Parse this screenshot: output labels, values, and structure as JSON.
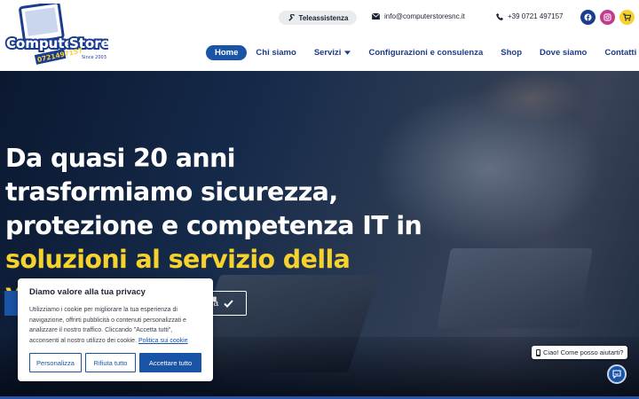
{
  "brand": {
    "logo_text": "Computer Store",
    "logo_phone": "0721497157",
    "logo_since": "Since 2003"
  },
  "topbar": {
    "teleassistenza": "Teleassistenza",
    "email": "info@computerstoresnc.it",
    "phone": "+39 0721 497157",
    "icons": [
      "wrench-icon",
      "mail-icon",
      "phone-icon",
      "facebook-icon",
      "instagram-icon",
      "cart-icon"
    ]
  },
  "nav": {
    "items": [
      {
        "label": "Home",
        "active": true
      },
      {
        "label": "Chi siamo"
      },
      {
        "label": "Servizi",
        "has_dropdown": true
      },
      {
        "label": "Configurazioni e consulenza"
      },
      {
        "label": "Shop"
      },
      {
        "label": "Dove siamo"
      },
      {
        "label": "Contatti"
      }
    ]
  },
  "hero": {
    "headline_white": "Da quasi 20 anni trasformiamo sicurezza, protezione e competenza IT in ",
    "headline_yellow": "soluzioni al servizio della vostra crescita",
    "headline_end": ".",
    "cta_secondary": "za"
  },
  "cookie": {
    "title": "Diamo valore alla tua privacy",
    "body": "Utilizziamo i cookie per migliorare la tua esperienza di navigazione, offrirti pubblicità o contenuti personalizzati e analizzare il nostro traffico. Cliccando \"Accetta tutti\", acconsenti al nostro utilizzo dei cookie. ",
    "policy_link": "Politica sui cookie",
    "btn_customize": "Personalizza",
    "btn_reject": "Rifiuta tutto",
    "btn_accept": "Accettare tutto"
  },
  "chat": {
    "bubble": "Ciao! Come posso aiutarti?"
  },
  "colors": {
    "brand_blue": "#1a54a6",
    "nav_text": "#1e3a8a",
    "accent_yellow": "#f5d22e",
    "instagram": "#c23b8e",
    "facebook": "#1a3d8f"
  }
}
